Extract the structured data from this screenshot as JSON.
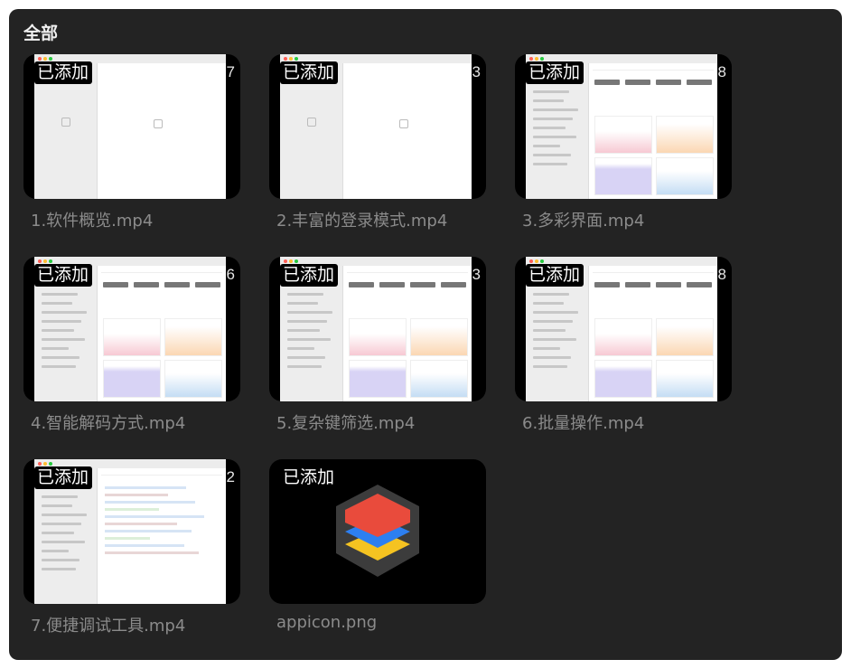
{
  "panel": {
    "title": "全部"
  },
  "badge_label": "已添加",
  "items": [
    {
      "caption": "1.软件概览.mp4",
      "duration": "27",
      "preview": "empty"
    },
    {
      "caption": "2.丰富的登录模式.mp4",
      "duration": "3",
      "preview": "empty"
    },
    {
      "caption": "3.多彩界面.mp4",
      "duration": "8",
      "preview": "dashboard"
    },
    {
      "caption": "4.智能解码方式.mp4",
      "duration": "6",
      "preview": "dashboard"
    },
    {
      "caption": "5.复杂键筛选.mp4",
      "duration": "3",
      "preview": "dashboard"
    },
    {
      "caption": "6.批量操作.mp4",
      "duration": "8",
      "preview": "dashboard"
    },
    {
      "caption": "7.便捷调试工具.mp4",
      "duration": "2",
      "preview": "code"
    },
    {
      "caption": "appicon.png",
      "duration": "",
      "preview": "appicon"
    }
  ],
  "colors": {
    "panel_bg": "#232323",
    "caption": "#8b8b8b",
    "icon_red": "#e94b3c",
    "icon_blue": "#2d7ff0",
    "icon_yellow": "#f5c321",
    "icon_frame": "#3c3c3c"
  }
}
